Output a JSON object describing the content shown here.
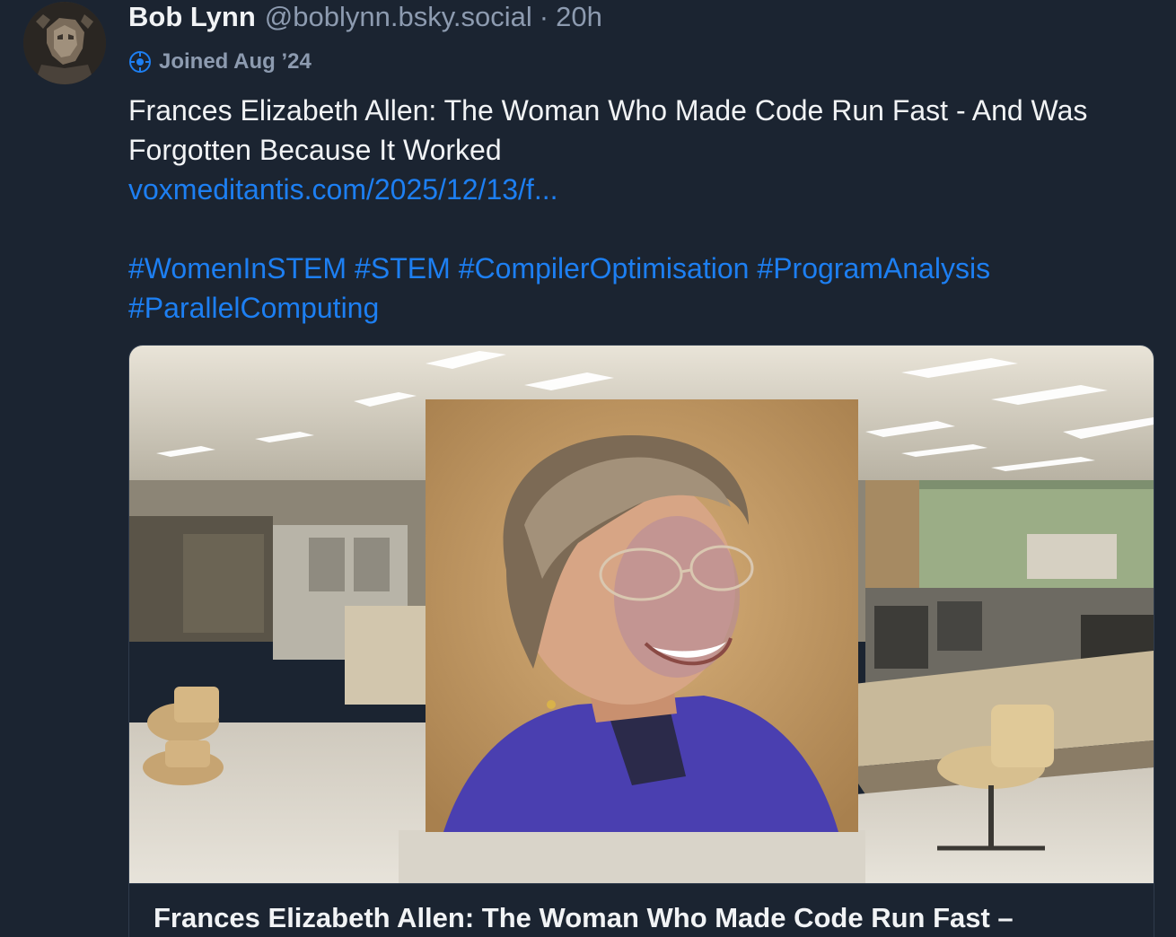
{
  "author": {
    "display_name": "Bob Lynn",
    "handle": "@boblynn.bsky.social",
    "separator": "·",
    "time": "20h",
    "joined": "Joined Aug ’24"
  },
  "post": {
    "text": "Frances Elizabeth Allen: The Woman Who Made Code Run Fast - And Was Forgotten Because It Worked",
    "link": "voxmeditantis.com/2025/12/13/f...",
    "hashtags": [
      "#WomenInSTEM",
      "#STEM",
      "#CompilerOptimisation",
      "#ProgramAnalysis",
      "#ParallelComputing"
    ]
  },
  "link_card": {
    "title": "Frances Elizabeth Allen: The Woman Who Made Code Run Fast –"
  },
  "colors": {
    "background": "#1b2431",
    "link": "#1d7ff2",
    "muted": "#8d9bb0",
    "text": "#f1f3f5"
  }
}
